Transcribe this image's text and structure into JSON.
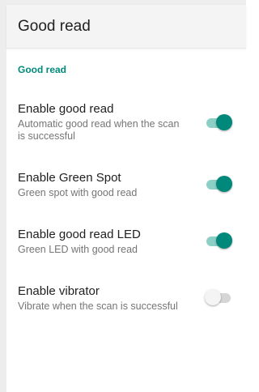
{
  "appbar": {
    "title": "Good read"
  },
  "section": {
    "header": "Good read"
  },
  "prefs": [
    {
      "title": "Enable good read",
      "summary": "Automatic good read when the scan is successful",
      "checked": true
    },
    {
      "title": "Enable Green Spot",
      "summary": "Green spot with good read",
      "checked": true
    },
    {
      "title": "Enable good read LED",
      "summary": "Green LED with good read",
      "checked": true
    },
    {
      "title": "Enable vibrator",
      "summary": "Vibrate when the scan is successful",
      "checked": false
    }
  ],
  "colors": {
    "accent": "#00897b",
    "accent_track": "#8bcfc6",
    "off_thumb": "#f4f4f4",
    "off_track": "#d6d6d6"
  }
}
